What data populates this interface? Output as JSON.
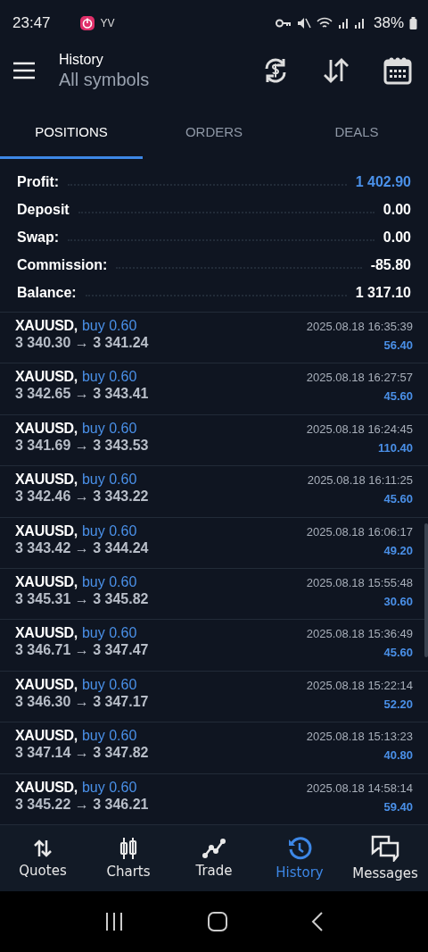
{
  "status_bar": {
    "time": "23:47",
    "carrier": "YV",
    "battery": "38%"
  },
  "header": {
    "title": "History",
    "subtitle": "All symbols"
  },
  "tabs": [
    {
      "label": "POSITIONS",
      "selected": true
    },
    {
      "label": "ORDERS",
      "selected": false
    },
    {
      "label": "DEALS",
      "selected": false
    }
  ],
  "summary": [
    {
      "label": "Profit:",
      "value": "1 402.90",
      "color": "#4a90e8"
    },
    {
      "label": "Deposit",
      "value": "0.00",
      "color": "#ffffff"
    },
    {
      "label": "Swap:",
      "value": "0.00",
      "color": "#ffffff"
    },
    {
      "label": "Commission:",
      "value": "-85.80",
      "color": "#ffffff"
    },
    {
      "label": "Balance:",
      "value": "1 317.10",
      "color": "#ffffff"
    }
  ],
  "positions": [
    {
      "symbol": "XAUUSD,",
      "order": "buy 0.60",
      "prices": "3 340.30 → 3 341.24",
      "time": "2025.08.18 16:35:39",
      "profit": "56.40"
    },
    {
      "symbol": "XAUUSD,",
      "order": "buy 0.60",
      "prices": "3 342.65 → 3 343.41",
      "time": "2025.08.18 16:27:57",
      "profit": "45.60"
    },
    {
      "symbol": "XAUUSD,",
      "order": "buy 0.60",
      "prices": "3 341.69 → 3 343.53",
      "time": "2025.08.18 16:24:45",
      "profit": "110.40"
    },
    {
      "symbol": "XAUUSD,",
      "order": "buy 0.60",
      "prices": "3 342.46 → 3 343.22",
      "time": "2025.08.18 16:11:25",
      "profit": "45.60"
    },
    {
      "symbol": "XAUUSD,",
      "order": "buy 0.60",
      "prices": "3 343.42 → 3 344.24",
      "time": "2025.08.18 16:06:17",
      "profit": "49.20"
    },
    {
      "symbol": "XAUUSD,",
      "order": "buy 0.60",
      "prices": "3 345.31 → 3 345.82",
      "time": "2025.08.18 15:55:48",
      "profit": "30.60"
    },
    {
      "symbol": "XAUUSD,",
      "order": "buy 0.60",
      "prices": "3 346.71 → 3 347.47",
      "time": "2025.08.18 15:36:49",
      "profit": "45.60"
    },
    {
      "symbol": "XAUUSD,",
      "order": "buy 0.60",
      "prices": "3 346.30 → 3 347.17",
      "time": "2025.08.18 15:22:14",
      "profit": "52.20"
    },
    {
      "symbol": "XAUUSD,",
      "order": "buy 0.60",
      "prices": "3 347.14 → 3 347.82",
      "time": "2025.08.18 15:13:23",
      "profit": "40.80"
    },
    {
      "symbol": "XAUUSD,",
      "order": "buy 0.60",
      "prices": "3 345.22 → 3 346.21",
      "time": "2025.08.18 14:58:14",
      "profit": "59.40"
    }
  ],
  "bottom_nav": [
    {
      "label": "Quotes",
      "kind": "quotes",
      "selected": false
    },
    {
      "label": "Charts",
      "kind": "charts",
      "selected": false
    },
    {
      "label": "Trade",
      "kind": "trade",
      "selected": false
    },
    {
      "label": "History",
      "kind": "history",
      "selected": true
    },
    {
      "label": "Messages",
      "kind": "messages",
      "selected": false
    }
  ]
}
